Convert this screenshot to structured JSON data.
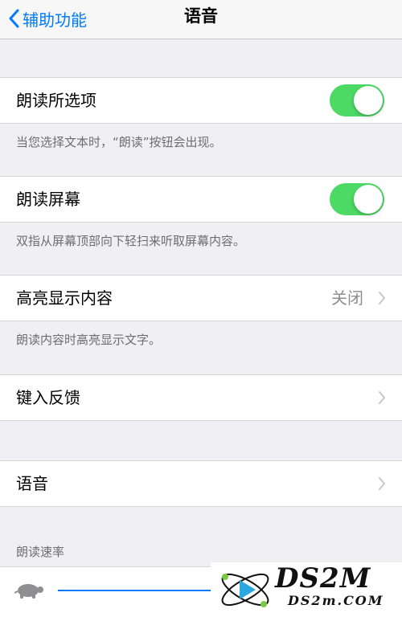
{
  "nav": {
    "back_label": "辅助功能",
    "title": "语音"
  },
  "speak_selection": {
    "label": "朗读所选项",
    "on": true,
    "footer": "当您选择文本时，“朗读”按钮会出现。"
  },
  "speak_screen": {
    "label": "朗读屏幕",
    "on": true,
    "footer": "双指从屏幕顶部向下轻扫来听取屏幕内容。"
  },
  "highlight": {
    "label": "高亮显示内容",
    "value": "关闭",
    "footer": "朗读内容时高亮显示文字。"
  },
  "typing_feedback": {
    "label": "键入反馈"
  },
  "voices": {
    "label": "语音"
  },
  "speaking_rate": {
    "header": "朗读速率"
  },
  "watermark": {
    "brand": "DS2M",
    "url": "DS2m.COM"
  },
  "colors": {
    "accent": "#007aff",
    "toggle_on": "#4cd964",
    "background": "#efeff4"
  }
}
